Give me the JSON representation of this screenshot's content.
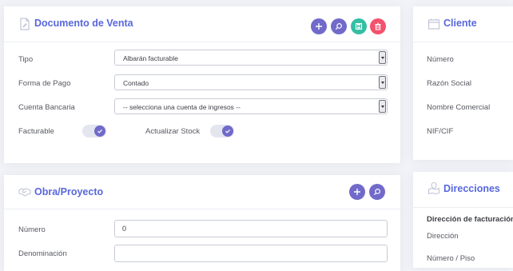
{
  "documento": {
    "title": "Documento de Venta",
    "header_icon": "document-edit-icon",
    "actions": [
      {
        "name": "add-button",
        "icon": "plus-icon",
        "color": "#716aca"
      },
      {
        "name": "search-button",
        "icon": "search-icon",
        "color": "#716aca"
      },
      {
        "name": "save-button",
        "icon": "save-icon",
        "color": "#34bfa3"
      },
      {
        "name": "delete-button",
        "icon": "trash-icon",
        "color": "#f4516c"
      }
    ],
    "fields": {
      "tipo": {
        "label": "Tipo",
        "value": "Albarán facturable"
      },
      "forma_pago": {
        "label": "Forma de Pago",
        "value": "Contado"
      },
      "cuenta": {
        "label": "Cuenta Bancaria",
        "value": "-- selecciona una cuenta de ingresos --"
      }
    },
    "toggles": {
      "facturable": {
        "label": "Facturable",
        "checked": true
      },
      "stock": {
        "label": "Actualizar Stock",
        "checked": true
      }
    }
  },
  "cliente": {
    "title": "Cliente",
    "header_icon": "window-icon",
    "labels": [
      "Número",
      "Razón Social",
      "Nombre Comercial",
      "NIF/CIF"
    ]
  },
  "obra": {
    "title": "Obra/Proyecto",
    "header_icon": "handshake-icon",
    "actions": [
      {
        "name": "add-button",
        "icon": "plus-icon",
        "color": "#716aca"
      },
      {
        "name": "search-button",
        "icon": "search-icon",
        "color": "#716aca"
      }
    ],
    "fields": {
      "numero": {
        "label": "Número",
        "value": "0"
      },
      "denominacion": {
        "label": "Denominación",
        "value": ""
      }
    }
  },
  "direcciones": {
    "title": "Direcciones",
    "header_icon": "map-pin-icon",
    "section_title": "Dirección de facturación:",
    "labels": [
      "Dirección",
      "Número / Piso"
    ]
  },
  "colors": {
    "accent": "#5867dd",
    "primary": "#716aca",
    "success": "#34bfa3",
    "danger": "#f4516c"
  }
}
